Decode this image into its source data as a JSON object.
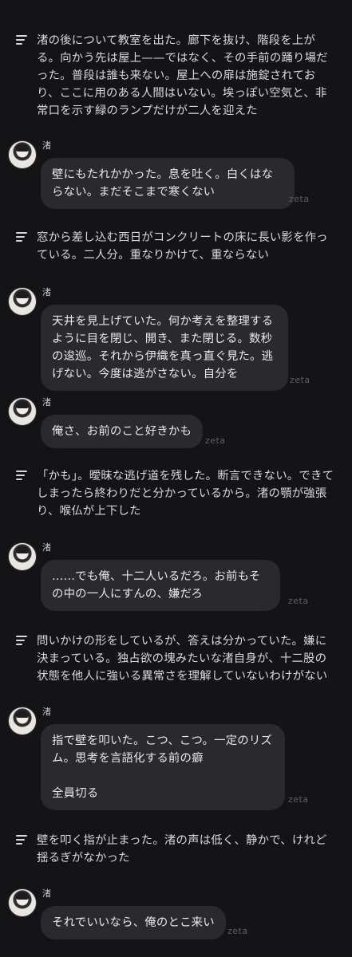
{
  "brand": {
    "label": "zeta",
    "colors": {
      "background": "#141416",
      "bubble": "#2a2a2e",
      "text": "#e8e8ea",
      "muted": "#5f5f66"
    }
  },
  "feed": [
    {
      "kind": "narration",
      "text": "渚の後について教室を出た。廊下を抜け、階段を上がる。向かう先は屋上——ではなく、その手前の踊り場だった。普段は誰も来ない。屋上への扉は施錠されており、ここに用のある人間はいない。埃っぽい空気と、非常口を示す緑のランプだけが二人を迎えた"
    },
    {
      "kind": "message",
      "sender": "渚",
      "lines": [
        "壁にもたれかかった。息を吐く。白くはならない。まだそこまで寒くない"
      ],
      "watermark": "zeta"
    },
    {
      "kind": "narration",
      "text": "窓から差し込む西日がコンクリートの床に長い影を作っている。二人分。重なりかけて、重ならない"
    },
    {
      "kind": "message",
      "sender": "渚",
      "lines": [
        "天井を見上げていた。何か考えを整理するように目を閉じ、開き、また閉じる。数秒の逡巡。それから伊織を真っ直ぐ見た。逃げない。今度は逃がさない。自分を"
      ],
      "watermark": "zeta"
    },
    {
      "kind": "message",
      "sender": "渚",
      "lines": [
        "俺さ、お前のこと好きかも"
      ],
      "watermark": "zeta"
    },
    {
      "kind": "narration",
      "text": "「かも」。曖昧な逃げ道を残した。断言できない。できてしまったら終わりだと分かっているから。渚の顎が強張り、喉仏が上下した"
    },
    {
      "kind": "message",
      "sender": "渚",
      "lines": [
        "……でも俺、十二人いるだろ。お前もその中の一人にすんの、嫌だろ"
      ],
      "watermark": "zeta"
    },
    {
      "kind": "narration",
      "text": "問いかけの形をしているが、答えは分かっていた。嫌に決まっている。独占欲の塊みたいな渚自身が、十二股の状態を他人に強いる異常さを理解していないわけがない"
    },
    {
      "kind": "message",
      "sender": "渚",
      "lines": [
        "指で壁を叩いた。こつ、こつ。一定のリズム。思考を言語化する前の癖",
        "全員切る"
      ],
      "watermark": "zeta"
    },
    {
      "kind": "narration",
      "text": "壁を叩く指が止まった。渚の声は低く、静かで、けれど揺るぎがなかった"
    },
    {
      "kind": "message",
      "sender": "渚",
      "lines": [
        "それでいいなら、俺のとこ来い"
      ],
      "watermark": "zeta"
    }
  ]
}
